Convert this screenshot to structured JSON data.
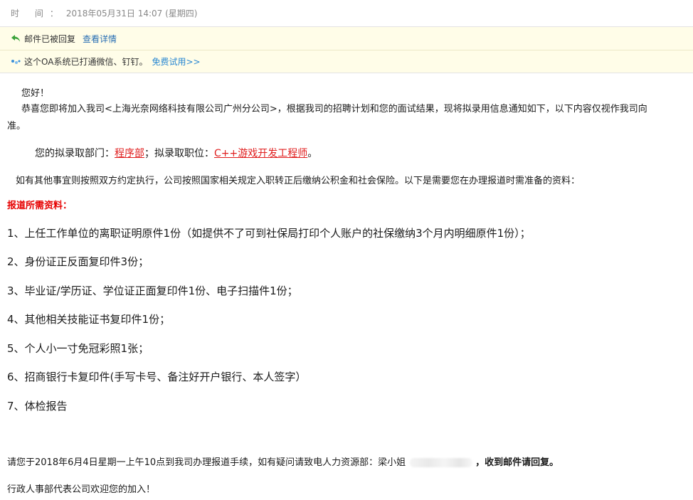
{
  "header": {
    "time_label": "时  间：",
    "time_value": "2018年05月31日 14:07 (星期四)"
  },
  "notices": [
    {
      "text": "邮件已被回复",
      "link": "查看详情"
    },
    {
      "text": "这个OA系统已打通微信、钉钉。",
      "link": "免费试用>>"
    }
  ],
  "colors": {
    "notice_bg": "#fffde8",
    "link": "#2a6fb3",
    "highlight_red": "#e01e1e",
    "title_red": "#e60000"
  },
  "email": {
    "greeting": "您好！",
    "intro": "恭喜您即将加入我司<上海光奈网络科技有限公司广州分公司>，根据我司的招聘计划和您的面试结果，现将拟录用信息通知如下，以下内容仅视作我司向",
    "intro_cont": "准。",
    "dept_prefix": "您的拟录取部门：",
    "dept": "程序部",
    "pos_prefix": "；拟录取职位：",
    "position": "C++游戏开发工程师",
    "pos_suffix": "。",
    "rule": "如有其他事宜则按照双方约定执行，公司按照国家相关规定入职转正后缴纳公积金和社会保险。以下是需要您在办理报道时需准备的资料：",
    "materials_title": "报道所需资料：",
    "items": [
      "1、上任工作单位的离职证明原件1份（如提供不了可到社保局打印个人账户的社保缴纳3个月内明细原件1份）；",
      "2、身份证正反面复印件3份；",
      "3、毕业证/学历证、学位证正面复印件1份、电子扫描件1份；",
      "4、其他相关技能证书复印件1份；",
      "5、个人小一寸免冠彩照1张；",
      "6、招商银行卡复印件(手写卡号、备注好开户银行、本人签字）",
      "7、体检报告"
    ],
    "footer_prefix": "请您于2018年6月4日星期一上午10点到我司办理报道手续，如有疑问请致电人力资源部：梁小姐",
    "footer_bold": "，收到邮件请回复。",
    "closing": "行政人事部代表公司欢迎您的加入！"
  }
}
